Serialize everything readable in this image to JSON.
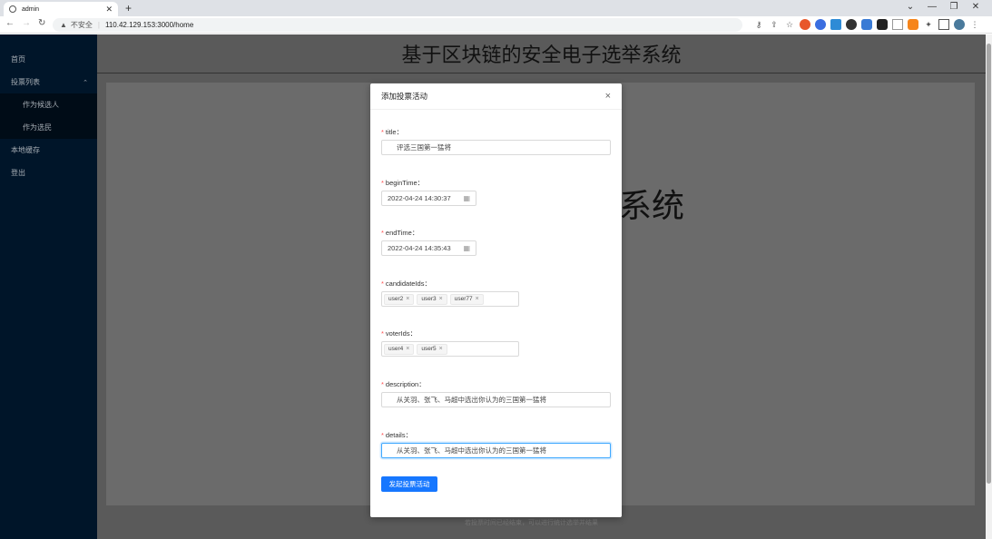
{
  "browser": {
    "tab_title": "admin",
    "tab_close": "✕",
    "new_tab": "+",
    "address_insecure": "不安全",
    "address_url": "110.42.129.153:3000/home",
    "window_controls": [
      "⌄",
      "—",
      "❐",
      "✕"
    ]
  },
  "sidebar": {
    "items": [
      {
        "label": "首页"
      },
      {
        "label": "投票列表",
        "expanded": true
      },
      {
        "label": "作为候选人"
      },
      {
        "label": "作为选民"
      },
      {
        "label": "本地缓存"
      },
      {
        "label": "登出"
      }
    ]
  },
  "header": {
    "title": "基于区块链的安全电子选举系统"
  },
  "background": {
    "big_text": "系统",
    "footer": "若投票时间已经结束，可以进行统计选举并结果"
  },
  "modal": {
    "title": "添加投票活动",
    "close": "×",
    "fields": {
      "title": {
        "label": "title",
        "value": "评选三国第一猛将"
      },
      "beginTime": {
        "label": "beginTime",
        "value": "2022-04-24 14:30:37"
      },
      "endTime": {
        "label": "endTime",
        "value": "2022-04-24 14:35:43"
      },
      "candidateIds": {
        "label": "candidateIds",
        "tags": [
          "user2",
          "user3",
          "user77"
        ]
      },
      "voterIds": {
        "label": "voterIds",
        "tags": [
          "user4",
          "user5"
        ]
      },
      "description": {
        "label": "description",
        "value": "从关羽、张飞、马超中选出你认为的三国第一猛将"
      },
      "details": {
        "label": "details",
        "value": "从关羽、张飞、马超中选出你认为的三国第一猛将"
      }
    },
    "submit": "发起投票活动",
    "required_mark": "*",
    "label_suffix": "："
  },
  "colors": {
    "primary": "#1677ff",
    "sidebar_bg": "#001529",
    "required": "#ff4d4f"
  }
}
